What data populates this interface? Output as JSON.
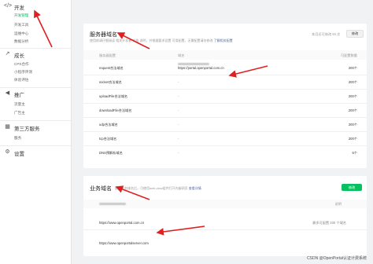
{
  "sidebar": {
    "groups": [
      {
        "icon": "code-icon",
        "title": "开发",
        "items": [
          "开发管理",
          "开发工具",
          "运维中心",
          "数据分析"
        ]
      },
      {
        "icon": "growth-icon",
        "title": "成长",
        "items": [
          "CPS合作",
          "小程序评测",
          "体验评估"
        ]
      },
      {
        "icon": "megaphone-icon",
        "title": "推广",
        "items": [
          "流量主",
          "广告主"
        ]
      },
      {
        "icon": "services-icon",
        "title": "第三方服务",
        "items": [
          "服务"
        ]
      },
      {
        "icon": "gear-icon",
        "title": "设置",
        "items": []
      }
    ]
  },
  "server_domains": {
    "title": "服务器域名",
    "desc": "使用前请仔细阅读 相关开发者 文档 说明，并根据要求设置 可用配置，无需配置请勿修改",
    "desc_link": "了解相关配置",
    "quota_text": "本月还可修改 50 次",
    "modify_button": "修改",
    "headers": {
      "type": "服务器配置",
      "domain": "域名",
      "limit": "可配置数量"
    },
    "rows": [
      {
        "type": "request合法域名",
        "domain": "https://portal.openportal.com.cn",
        "limit": "200个"
      },
      {
        "type": "socket合法域名",
        "domain": "-",
        "limit": "200个"
      },
      {
        "type": "uploadFile合法域名",
        "domain": "-",
        "limit": "200个"
      },
      {
        "type": "downloadFile合法域名",
        "domain": "-",
        "limit": "200个"
      },
      {
        "type": "udp合法域名",
        "domain": "-",
        "limit": "200个"
      },
      {
        "type": "tcp合法域名",
        "domain": "-",
        "limit": "200个"
      },
      {
        "type": "DNS预解析域名",
        "domain": "-",
        "limit": "5个"
      }
    ]
  },
  "business_domains": {
    "title": "业务域名",
    "desc": "配置业务域名后，可使用web-view组件打开内嵌网页",
    "desc_link": "查看详情",
    "modify_button": "修改",
    "header_right": "说明",
    "rows": [
      {
        "domain": "https://www.openportal.com.cn",
        "note": "最多可配置 200 个域名"
      },
      {
        "domain": "https://www.openportalserver.com",
        "note": ""
      }
    ]
  },
  "watermark": "CSDN @OpenPortal认证计费系统",
  "colors": {
    "accent": "#07c160",
    "arrow": "#e02020",
    "link": "#576b95"
  }
}
